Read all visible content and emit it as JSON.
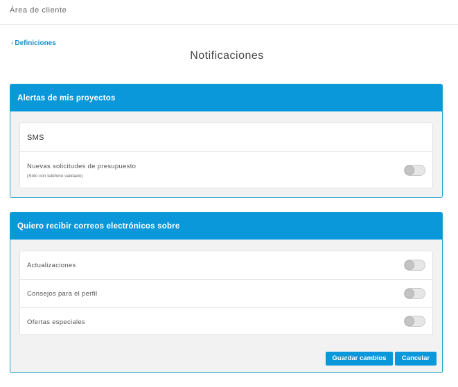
{
  "header": {
    "title": "Área de cliente"
  },
  "nav": {
    "back_chevron": "‹",
    "back_label": "Definiciones"
  },
  "page": {
    "title": "Notificaciones"
  },
  "projects_panel": {
    "title": "Alertas de mis proyectos",
    "sms_label": "SMS",
    "items": [
      {
        "label": "Nuevas solicitudes de presupuesto",
        "note": "(Sólo con teléfono validado)",
        "enabled": false
      }
    ]
  },
  "email_panel": {
    "title": "Quiero recibir correos electrónicos sobre",
    "items": [
      {
        "label": "Actualizaciones",
        "enabled": false
      },
      {
        "label": "Consejos para el perfil",
        "enabled": false
      },
      {
        "label": "Ofertas especiales",
        "enabled": false
      }
    ],
    "save_label": "Guardar cambios",
    "cancel_label": "Cancelar"
  },
  "colors": {
    "accent": "#0a98db",
    "panel_border": "#1aa0c4",
    "link": "#1a8fc7",
    "panel_bg": "#f2f2f2"
  },
  "icons": {
    "toggle": "toggle-switch-icon",
    "back": "chevron-left-icon"
  }
}
